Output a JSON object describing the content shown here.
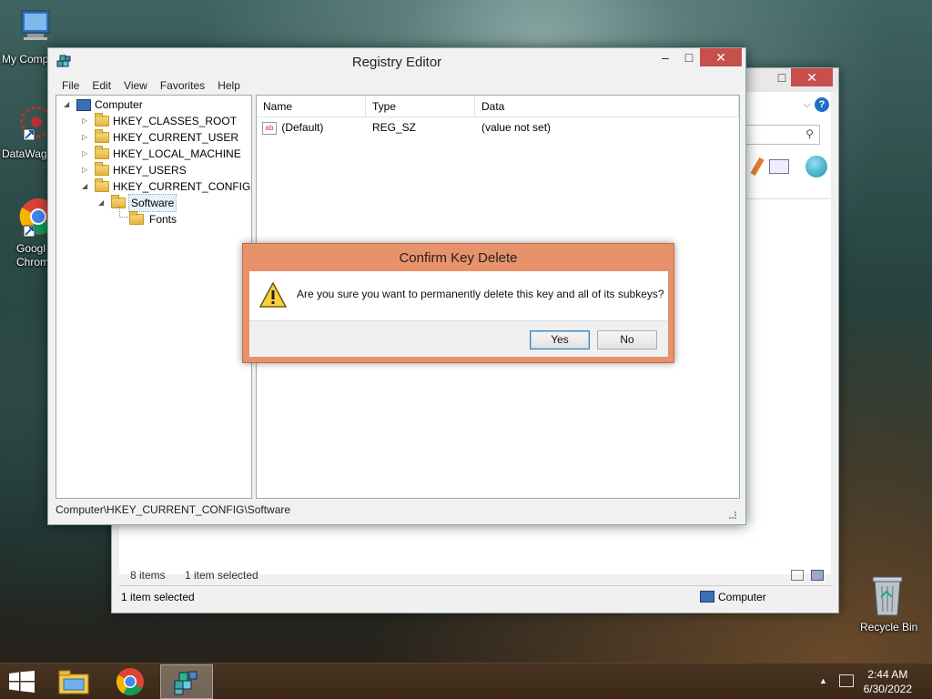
{
  "desktop": {
    "icons": [
      {
        "label": "My Comp",
        "name": "my-computer"
      },
      {
        "label": "DataWag",
        "name": "datawag"
      },
      {
        "label": "Googl\nChrom",
        "name": "google-chrome"
      },
      {
        "label": "Recycle Bin",
        "name": "recycle-bin"
      }
    ]
  },
  "explorer": {
    "items_count": "8 items",
    "items_selected": "1 item selected",
    "status_selected": "1 item selected",
    "status_location": "Computer"
  },
  "regedit": {
    "title": "Registry Editor",
    "menu": [
      "File",
      "Edit",
      "View",
      "Favorites",
      "Help"
    ],
    "tree": {
      "root": "Computer",
      "hives": [
        "HKEY_CLASSES_ROOT",
        "HKEY_CURRENT_USER",
        "HKEY_LOCAL_MACHINE",
        "HKEY_USERS",
        "HKEY_CURRENT_CONFIG"
      ],
      "selected": "Software",
      "child": "Fonts"
    },
    "columns": {
      "name": "Name",
      "type": "Type",
      "data": "Data"
    },
    "values": [
      {
        "name": "(Default)",
        "type": "REG_SZ",
        "data": "(value not set)"
      }
    ],
    "statusbar": "Computer\\HKEY_CURRENT_CONFIG\\Software",
    "controls": {
      "minimize": "–",
      "maximize": "□",
      "close": "✕"
    }
  },
  "dialog": {
    "title": "Confirm Key Delete",
    "message": "Are you sure you want to permanently delete this key and all of its subkeys?",
    "yes_label": "Yes",
    "no_label": "No"
  },
  "taskbar": {
    "time": "2:44 AM",
    "date": "6/30/2022",
    "apps": [
      "file-explorer",
      "google-chrome",
      "registry-editor"
    ]
  },
  "colors": {
    "dialog_frame": "#e8926b",
    "close_button": "#c7504c",
    "taskbar": "#3a2818"
  }
}
